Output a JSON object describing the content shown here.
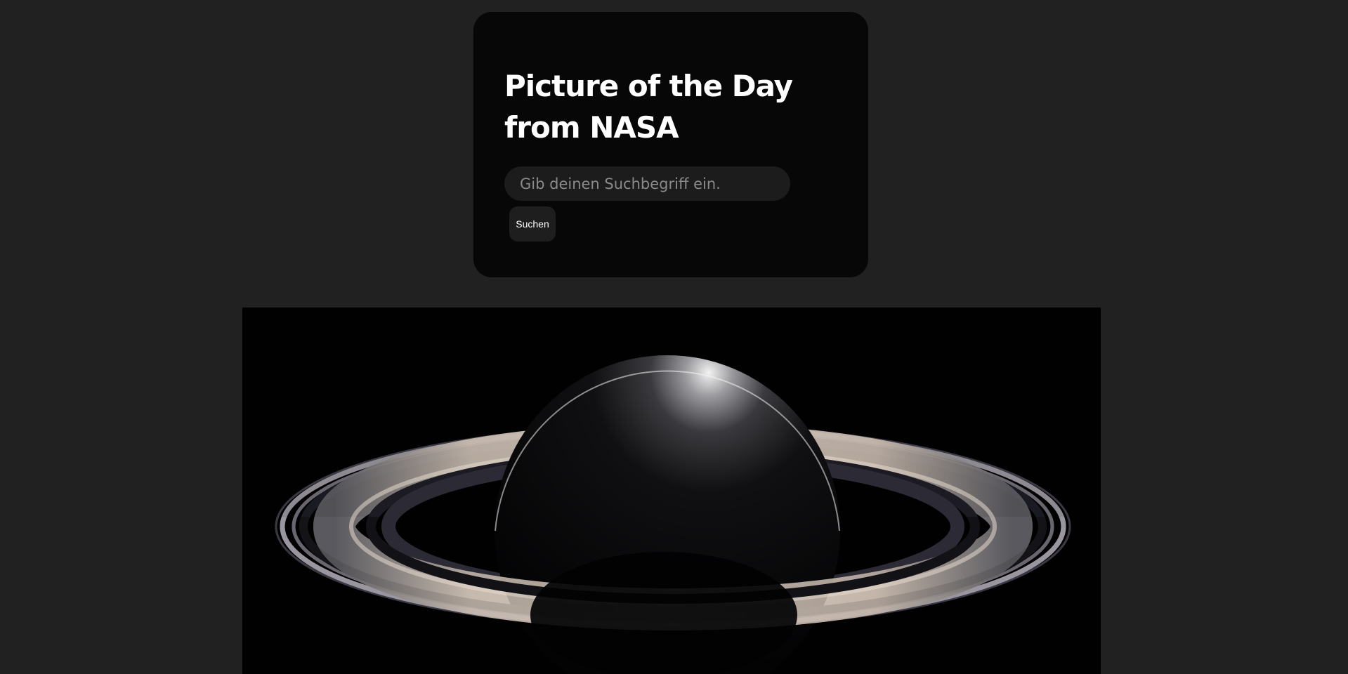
{
  "header": {
    "title": "Picture of the Day from NASA"
  },
  "search": {
    "placeholder": "Gib deinen Suchbegriff ein.",
    "value": "",
    "button_label": "Suchen"
  },
  "apod": {
    "subject": "saturn-with-rings"
  },
  "colors": {
    "page_background": "#212121",
    "card_background": "#070707",
    "input_background": "#1c1c1c",
    "button_background": "#1e1e1e",
    "text_primary": "#ffffff",
    "placeholder_text": "#8a8a8a"
  }
}
